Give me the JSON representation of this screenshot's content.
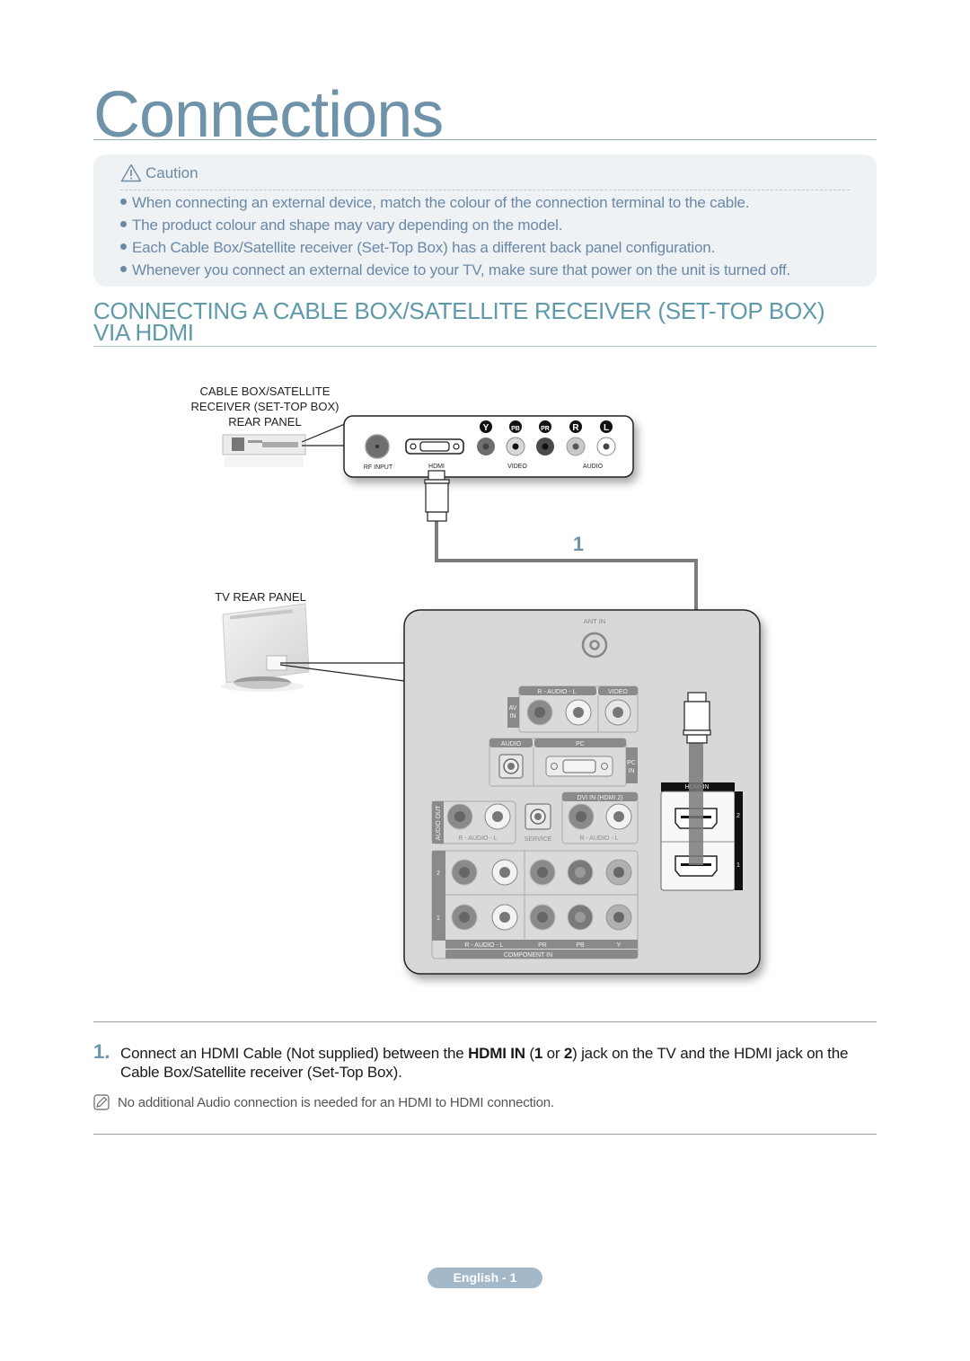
{
  "page": {
    "title": "Connections"
  },
  "caution": {
    "heading": "Caution",
    "icon": "warning-triangle-icon",
    "items": [
      "When connecting an external device, match the colour of the connection terminal to the cable.",
      "The product colour and shape may vary depending on the model.",
      "Each Cable Box/Satellite receiver (Set-Top Box) has a different back panel configuration.",
      "Whenever you connect an external device to your TV, make sure that power on the unit is turned off."
    ]
  },
  "section": {
    "title_line1": "CONNECTING A CABLE BOX/SATELLITE RECEIVER (SET-TOP BOX)",
    "title_line2": "VIA HDMI"
  },
  "diagram": {
    "stb_label_line1": "CABLE BOX/SATELLITE",
    "stb_label_line2": "RECEIVER (SET-TOP BOX)",
    "stb_label_line3": "REAR PANEL",
    "stb_ports": {
      "rf_input": "RF INPUT",
      "hdmi": "HDMI",
      "video": "VIDEO",
      "audio": "AUDIO",
      "jack_letters": [
        "Y",
        "PB",
        "PR",
        "R",
        "L"
      ]
    },
    "cable_number": "1",
    "tv_label": "TV REAR PANEL",
    "tv_ports": {
      "ant_in": "ANT IN",
      "av_audio": "R - AUDIO - L",
      "av_video": "VIDEO",
      "av_in_line1": "AV",
      "av_in_line2": "IN",
      "pc_audio": "AUDIO",
      "pc": "PC",
      "pc_in_line1": "PC",
      "pc_in_line2": "IN",
      "audio_out": "AUDIO OUT",
      "audio_out_sub": "R - AUDIO - L",
      "service": "SERVICE",
      "dvi_in": "DVI IN (HDMI 2)",
      "dvi_sub": "R - AUDIO - L",
      "component_row2": "2",
      "component_row1": "1",
      "component_audio": "R - AUDIO - L",
      "component_pr": "PR",
      "component_pb": "PB",
      "component_y": "Y",
      "component_in": "COMPONENT IN",
      "hdmi_in": "HDMI IN",
      "hdmi_2": "2",
      "hdmi_1": "1"
    }
  },
  "instructions": {
    "step_number": "1.",
    "step_text_pre": "Connect an HDMI Cable (Not supplied) between the ",
    "step_bold_1": "HDMI IN",
    "step_text_mid1": " (",
    "step_bold_2": "1",
    "step_text_mid2": " or ",
    "step_bold_3": "2",
    "step_text_post": ") jack on the TV and the HDMI jack on the Cable Box/Satellite receiver (Set-Top Box).",
    "note": "No additional Audio connection is needed for an HDMI to HDMI connection."
  },
  "footer": {
    "page_label": "English - 1"
  },
  "colors": {
    "title": "#6f93a8",
    "section_title": "#5f9aac",
    "caution_text": "#6b88a6",
    "caution_bg": "#eef2f5",
    "panel_gray": "#d8d8d8",
    "badge_bg": "#a3b9c9"
  }
}
